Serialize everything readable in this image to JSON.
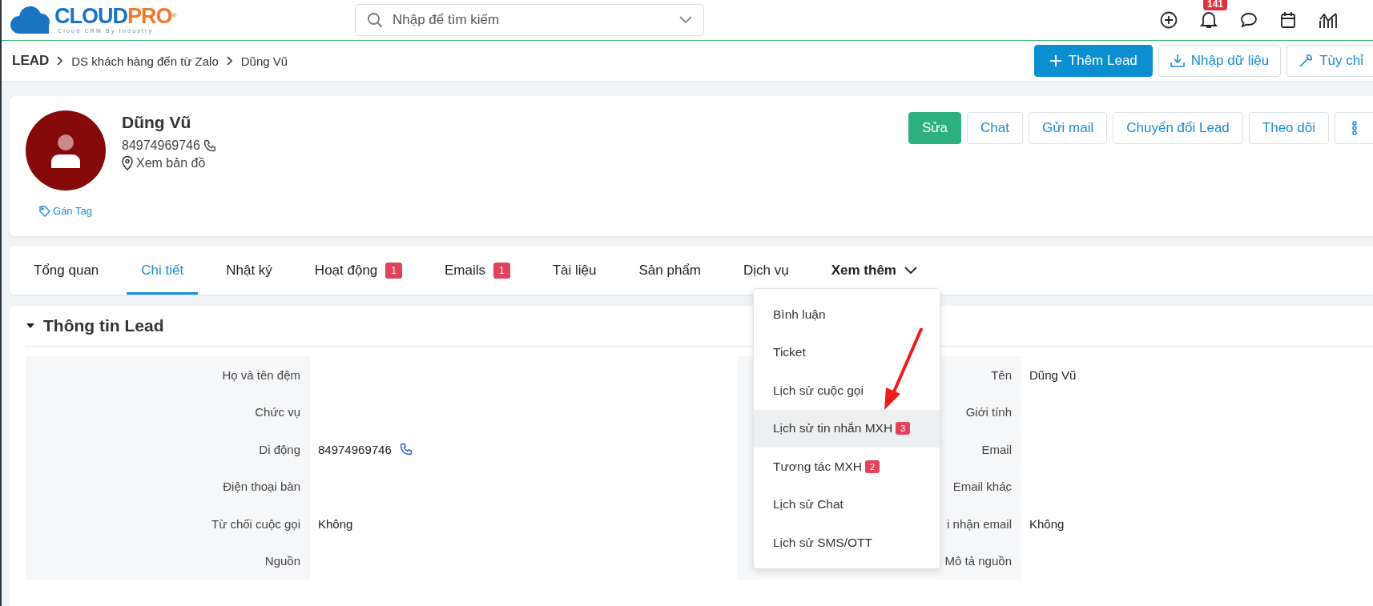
{
  "header": {
    "logo": {
      "word_1": "CLOUD",
      "word_2": "PRO",
      "mark": "®",
      "tagline": "Cloud CRM By Industry"
    },
    "search": {
      "placeholder": "Nhập để tìm kiếm"
    },
    "notification_count": "141"
  },
  "breadcrumb": {
    "items": [
      "LEAD",
      "DS khách hàng đến từ Zalo",
      "Dũng Vũ"
    ],
    "buttons": [
      {
        "label": "Thêm Lead",
        "kind": "primary"
      },
      {
        "label": "Nhập dữ liệu",
        "kind": "import"
      },
      {
        "label": "Tùy chỉ",
        "kind": "settings"
      }
    ]
  },
  "profile": {
    "name": "Dũng Vũ",
    "phone": "84974969746",
    "map_link": "Xem bản đồ",
    "tag_link": "Gán Tag",
    "actions": [
      {
        "label": "Sửa",
        "kind": "primary"
      },
      {
        "label": "Chat",
        "kind": "outline"
      },
      {
        "label": "Gửi mail",
        "kind": "outline"
      },
      {
        "label": "Chuyển đổi Lead",
        "kind": "outline"
      },
      {
        "label": "Theo dõi",
        "kind": "outline"
      },
      {
        "kind": "more"
      }
    ]
  },
  "tabs": [
    {
      "label": "Tổng quan",
      "selected": false
    },
    {
      "label": "Chi tiết",
      "selected": true
    },
    {
      "label": "Nhật ký",
      "selected": false
    },
    {
      "label": "Hoạt động",
      "selected": false,
      "badge": "1"
    },
    {
      "label": "Emails",
      "selected": false,
      "badge": "1"
    },
    {
      "label": "Tài liệu",
      "selected": false
    },
    {
      "label": "Sản phẩm",
      "selected": false
    },
    {
      "label": "Dịch vụ",
      "selected": false
    },
    {
      "label": "Xem thêm",
      "selected": false,
      "kind": "dropdown"
    }
  ],
  "more_menu": {
    "open": true,
    "items": [
      {
        "label": "Bình luận",
        "highlighted": false
      },
      {
        "label": "Ticket",
        "highlighted": false
      },
      {
        "label": "Lịch sử cuộc gọi",
        "highlighted": false
      },
      {
        "label": "Lịch sử tin nhắn MXH",
        "highlighted": true,
        "badge": "3"
      },
      {
        "label": "Tương tác MXH",
        "highlighted": false,
        "badge": "2"
      },
      {
        "label": "Lịch sử Chat",
        "highlighted": false
      },
      {
        "label": "Lịch sử SMS/OTT",
        "highlighted": false
      }
    ]
  },
  "section": {
    "title": "Thông tin Lead",
    "expanded": true,
    "left_fields": [
      {
        "label": "Họ và tên đệm"
      },
      {
        "label": "Chức vụ"
      },
      {
        "label": "Di động",
        "value": "84974969746",
        "kind": "phone"
      },
      {
        "label": "Điện thoại bàn"
      },
      {
        "label": "Từ chối cuộc gọi",
        "value": "Không"
      },
      {
        "label": "Nguồn"
      }
    ],
    "right_fields": [
      {
        "label": "Tên",
        "value": "Dũng Vũ"
      },
      {
        "label": "Giới tính"
      },
      {
        "label": "Email"
      },
      {
        "label": "Email khác"
      },
      {
        "label": "i nhận email",
        "value": "Không"
      },
      {
        "label": "Mô tả nguồn"
      }
    ]
  }
}
